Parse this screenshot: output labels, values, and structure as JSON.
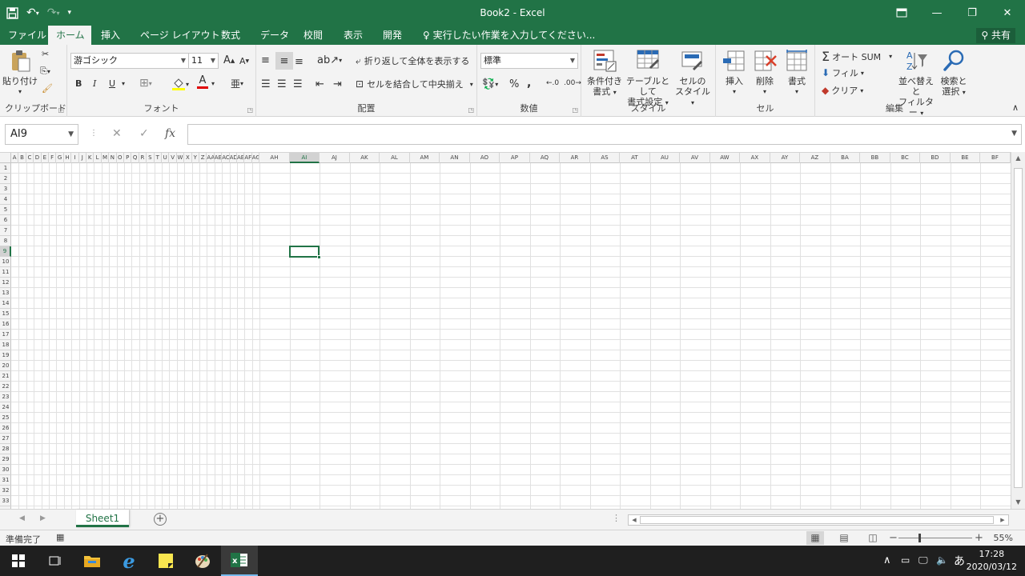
{
  "titlebar": {
    "title": "Book2 - Excel",
    "save_icon": "save-icon",
    "undo_icon": "undo-icon",
    "redo_icon": "redo-icon"
  },
  "tabs": {
    "file": "ファイル",
    "home": "ホーム",
    "insert": "挿入",
    "page_layout": "ページ レイアウト",
    "formulas": "数式",
    "data": "データ",
    "review": "校閲",
    "view": "表示",
    "developer": "開発",
    "tell_me": "実行したい作業を入力してください...",
    "share": "共有"
  },
  "ribbon": {
    "clipboard": {
      "label": "クリップボード",
      "paste": "貼り付け"
    },
    "font": {
      "label": "フォント",
      "font_name": "游ゴシック",
      "font_size": "11",
      "bold": "B",
      "italic": "I",
      "underline": "U",
      "grow": "A",
      "shrink": "A",
      "font_color_letter": "A"
    },
    "alignment": {
      "label": "配置",
      "wrap_text": "折り返して全体を表示する",
      "merge_center": "セルを結合して中央揃え"
    },
    "number": {
      "label": "数値",
      "format": "標準",
      "percent": "%",
      "comma": ","
    },
    "styles": {
      "label": "スタイル",
      "conditional_1": "条件付き",
      "conditional_2": "書式",
      "table_1": "テーブルとして",
      "table_2": "書式設定",
      "cell_1": "セルの",
      "cell_2": "スタイル"
    },
    "cells": {
      "label": "セル",
      "insert": "挿入",
      "delete": "削除",
      "format": "書式"
    },
    "editing": {
      "label": "編集",
      "autosum": "オート SUM",
      "fill": "フィル",
      "clear": "クリア",
      "sort_1": "並べ替えと",
      "sort_2": "フィルター",
      "find_1": "検索と",
      "find_2": "選択"
    }
  },
  "formula_bar": {
    "name_box": "AI9",
    "fx": "fx",
    "cancel": "✕",
    "enter": "✓",
    "value": ""
  },
  "grid": {
    "columns": [
      "A",
      "B",
      "C",
      "D",
      "E",
      "F",
      "G",
      "H",
      "I",
      "J",
      "K",
      "L",
      "M",
      "N",
      "O",
      "P",
      "Q",
      "R",
      "S",
      "T",
      "U",
      "V",
      "W",
      "X",
      "Y",
      "Z",
      "AA",
      "AB",
      "AC",
      "AD",
      "AE",
      "AF",
      "AG",
      "AH",
      "AI",
      "AJ",
      "AK",
      "AL",
      "AM",
      "AN",
      "AO",
      "AP",
      "AQ",
      "AR",
      "AS",
      "AT",
      "AU",
      "AV",
      "AW",
      "AX",
      "AY",
      "AZ",
      "BA",
      "BB",
      "BC",
      "BD",
      "BE",
      "BF"
    ],
    "rows": [
      "1",
      "2",
      "3",
      "4",
      "5",
      "6",
      "7",
      "8",
      "9",
      "10",
      "11",
      "12",
      "13",
      "14",
      "15",
      "16",
      "17",
      "18",
      "19",
      "20",
      "21",
      "22",
      "23",
      "24",
      "25",
      "26",
      "27",
      "28",
      "29",
      "30",
      "31",
      "32",
      "33"
    ],
    "selected_column": "AI",
    "selected_row": "9"
  },
  "sheets": {
    "active": "Sheet1",
    "add": "+"
  },
  "status": {
    "ready": "準備完了",
    "zoom": "55%",
    "zoom_fraction": 0.28
  },
  "taskbar": {
    "time": "17:28",
    "date": "2020/03/12",
    "ime": "あ"
  },
  "colors": {
    "accent": "#217346"
  }
}
